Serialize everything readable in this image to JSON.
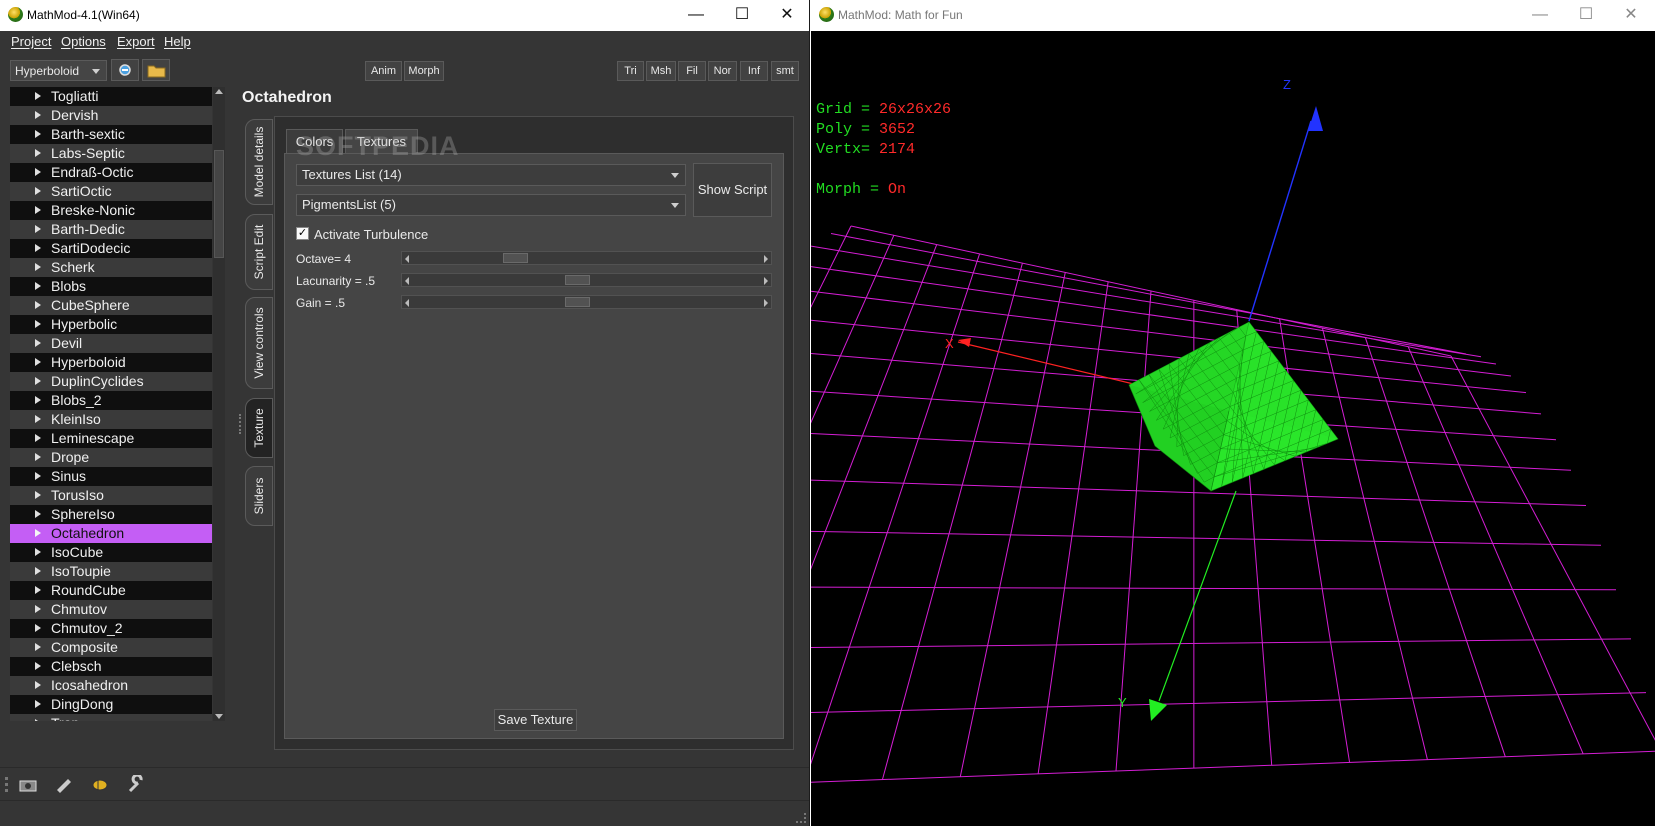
{
  "left_window": {
    "title": "MathMod-4.1(Win64)",
    "menu": [
      "Project",
      "Options",
      "Export",
      "Help"
    ],
    "model_combo": "Hyperboloid",
    "buttons": {
      "anim": "Anim",
      "morph": "Morph",
      "tri": "Tri",
      "msh": "Msh",
      "fil": "Fil",
      "nor": "Nor",
      "inf": "Inf",
      "smt": "smt"
    },
    "model_list": [
      "Togliatti",
      "Dervish",
      "Barth-sextic",
      "Labs-Septic",
      "Endraß-Octic",
      "SartiOctic",
      "Breske-Nonic",
      "Barth-Dedic",
      "SartiDodecic",
      "Scherk",
      "Blobs",
      "CubeSphere",
      "Hyperbolic",
      "Devil",
      "Hyperboloid",
      "DuplinCyclides",
      "Blobs_2",
      "KleinIso",
      "Leminescape",
      "Drope",
      "Sinus",
      "TorusIso",
      "SphereIso",
      "Octahedron",
      "IsoCube",
      "IsoToupie",
      "RoundCube",
      "Chmutov",
      "Chmutov_2",
      "Composite",
      "Clebsch",
      "Icosahedron",
      "DingDong",
      "Trap"
    ],
    "selected_model": "Octahedron",
    "model_title": "Octahedron",
    "side_tabs": [
      "Model details",
      "Script Edit",
      "View controls",
      "Texture",
      "Sliders"
    ],
    "active_side_tab": "Texture",
    "texture_tabs": [
      "Colors",
      "Textures"
    ],
    "active_texture_tab": "Textures",
    "textures_dropdown": "Textures List (14)",
    "pigments_dropdown": "PigmentsList (5)",
    "show_script": "Show Script",
    "turbulence_label": "Activate Turbulence",
    "turbulence_checked": true,
    "sliders": [
      {
        "label": "Octave= 4",
        "value": 0.28
      },
      {
        "label": "Lacunarity = .5",
        "value": 0.47
      },
      {
        "label": "Gain = .5",
        "value": 0.47
      }
    ],
    "save_texture": "Save Texture",
    "watermark": "SOFTPEDIA"
  },
  "right_window": {
    "title": "MathMod: Math for Fun",
    "hud": [
      {
        "key": "Grid =  ",
        "value": "26x26x26"
      },
      {
        "key": "Poly =  ",
        "value": "3652"
      },
      {
        "key": "Vertx=  ",
        "value": "2174"
      },
      {
        "key": "Morph = ",
        "value": "On"
      }
    ],
    "axes": {
      "x": "X",
      "y": "Y",
      "z": "Z"
    },
    "colors": {
      "grid": "#d41ed4",
      "shape": "#22e022",
      "x_axis": "#ff2222",
      "y_axis": "#22ee22",
      "z_axis": "#2233ff"
    }
  }
}
